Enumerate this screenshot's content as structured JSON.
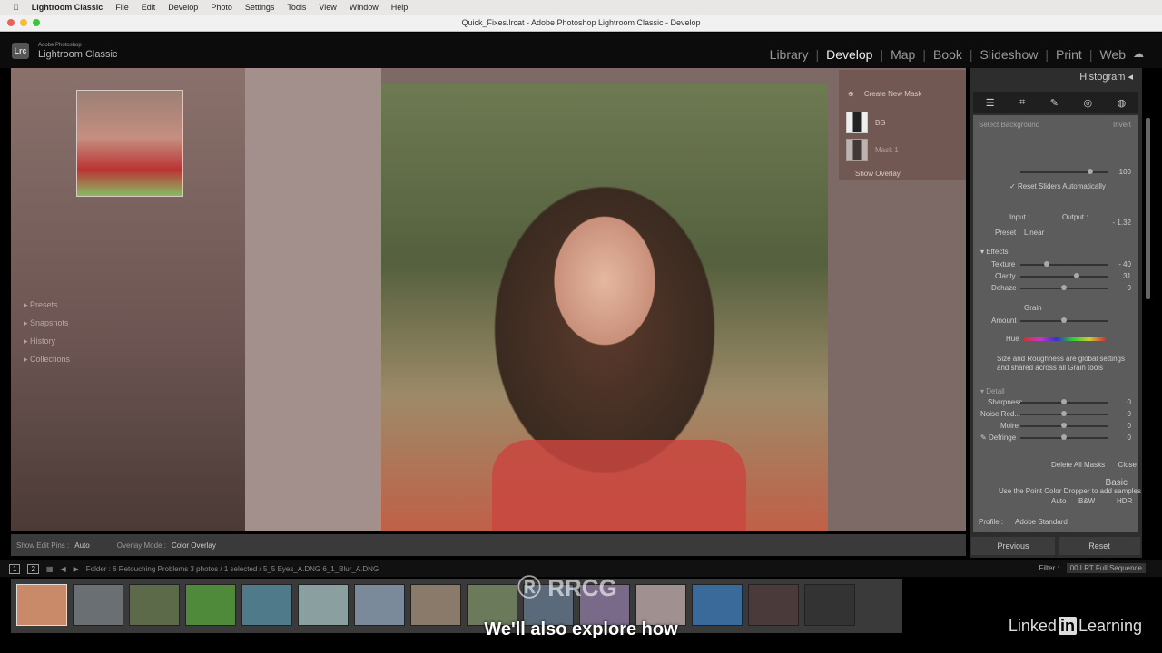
{
  "menubar": {
    "app": "Lightroom Classic",
    "items": [
      "File",
      "Edit",
      "Develop",
      "Photo",
      "Settings",
      "Tools",
      "View",
      "Window",
      "Help"
    ]
  },
  "window": {
    "title": "Quick_Fixes.lrcat - Adobe Photoshop Lightroom Classic - Develop"
  },
  "identity": {
    "badge": "Lrc",
    "line1": "Adobe Photoshop",
    "line2": "Lightroom Classic"
  },
  "modules": [
    "Library",
    "Develop",
    "Map",
    "Book",
    "Slideshow",
    "Print",
    "Web"
  ],
  "active_module": "Develop",
  "left_panel": [
    "Presets",
    "Snapshots",
    "History",
    "Collections"
  ],
  "masks": {
    "create": "Create New Mask",
    "items": [
      "BG",
      "Mask 1"
    ],
    "show_overlay": "Show Overlay"
  },
  "toolbar": {
    "pins_label": "Show Edit Pins :",
    "pins_value": "Auto",
    "mode_label": "Overlay Mode :",
    "mode_value": "Color Overlay"
  },
  "right": {
    "histogram": "Histogram",
    "select": "Select Background",
    "invert": "Invert",
    "amount_value": "100",
    "reset_sliders": "Reset Sliders Automatically",
    "input": "Input :",
    "output": "Output :",
    "preset_label": "Preset :",
    "preset_value": "Linear",
    "exposure": "- 1.32",
    "effects": "Effects",
    "texture": "Texture",
    "texture_value": "- 40",
    "clarity": "Clarity",
    "clarity_value": "31",
    "dehaze": "Dehaze",
    "dehaze_value": "0",
    "grain": "Grain",
    "amount": "Amount",
    "hue": "Hue",
    "grain_note": "Size and Roughness are global settings and shared across all Grain tools",
    "sharpness": "Sharpness",
    "noise": "Noise Red...",
    "moire": "Moire",
    "defringe": "Defringe",
    "zero": "0",
    "delete_all": "Delete All Masks",
    "close": "Close",
    "basic": "Basic",
    "dropper_note": "Use the Point Color Dropper to add samples",
    "auto": "Auto",
    "bw": "B&W",
    "hdr": "HDR",
    "profile_label": "Profile :",
    "profile_value": "Adobe Standard",
    "previous": "Previous",
    "reset": "Reset"
  },
  "filmstrip": {
    "view1": "1",
    "view2": "2",
    "path": "Folder : 6 Retouching Problems   3 photos / 1 selected / 5_5 Eyes_A.DNG   6_1_Blur_A.DNG",
    "filter_label": "Filter :",
    "filter_value": "00 LRT Full Sequence",
    "thumb_colors": [
      "#c98a6a",
      "#6a6f74",
      "#5c6a4a",
      "#4f8a3a",
      "#4f7a8a",
      "#8aa0a0",
      "#7a8a9a",
      "#8a7a6a",
      "#6a7a5a",
      "#5a6a7a",
      "#7a6a8a",
      "#a09090",
      "#3a6a9a",
      "#4a3a3a",
      "#333"
    ]
  },
  "subtitle": "We'll also explore how",
  "watermark": "RRCG",
  "logo": {
    "a": "Linked",
    "b": "in",
    "c": "Learning"
  }
}
